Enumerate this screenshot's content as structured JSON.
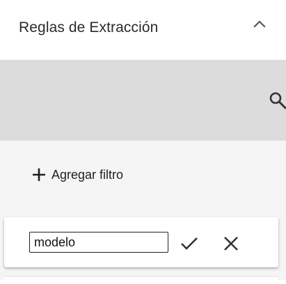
{
  "panel": {
    "title": "Reglas de Extracción",
    "toggle_icon": "chevron-up-icon"
  },
  "search": {
    "icon": "search-icon"
  },
  "filters": {
    "add_label": "Agregar filtro",
    "add_icon": "plus-icon",
    "editing_row": {
      "input_value": "modelo",
      "confirm_icon": "check-icon",
      "cancel_icon": "close-icon"
    }
  },
  "colors": {
    "search_bar_bg": "#dcdcdc",
    "filter_area_bg": "#f5f5f5",
    "card_bg": "#ffffff",
    "icon": "#333333"
  }
}
